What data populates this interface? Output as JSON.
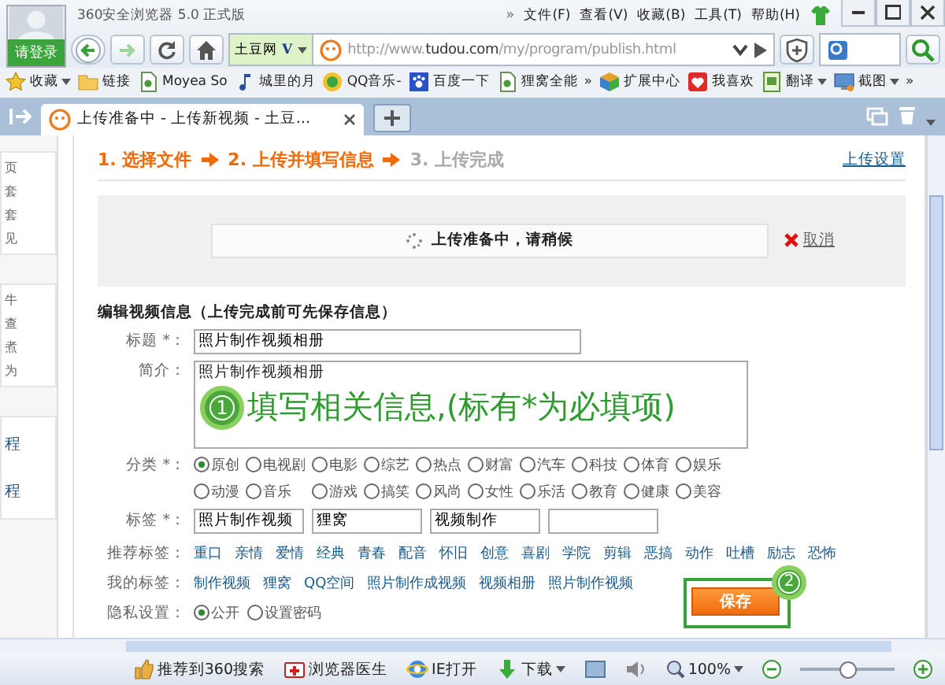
{
  "titlebar": {
    "login": "请登录",
    "title": "360安全浏览器 5.0 正式版",
    "more": "»",
    "menu": [
      "文件(F)",
      "查看(V)",
      "收藏(B)",
      "工具(T)",
      "帮助(H)"
    ]
  },
  "nav": {
    "site": "土豆网",
    "site_v": "V",
    "url_prefix": "http://www.",
    "url_domain": "tudou.com",
    "url_path": "/my/program/publish.html"
  },
  "bookmarks": [
    {
      "label": "收藏",
      "kind": "star",
      "menu": true
    },
    {
      "label": "链接",
      "kind": "folder",
      "menu": false
    },
    {
      "label": "Moyea So",
      "kind": "page",
      "menu": false
    },
    {
      "label": "城里的月",
      "kind": "note",
      "menu": false
    },
    {
      "label": "QQ音乐-",
      "kind": "disc",
      "menu": false
    },
    {
      "label": "百度一下",
      "kind": "paw",
      "menu": false
    },
    {
      "label": "狸窝全能",
      "kind": "page",
      "menu": false
    },
    {
      "label": "»",
      "kind": "more",
      "menu": false
    },
    {
      "label": "扩展中心",
      "kind": "cube",
      "menu": false
    },
    {
      "label": "我喜欢",
      "kind": "heart",
      "menu": false
    },
    {
      "label": "翻译",
      "kind": "book",
      "menu": true
    },
    {
      "label": "截图",
      "kind": "screen",
      "menu": true
    },
    {
      "label": "»",
      "kind": "more",
      "menu": false
    }
  ],
  "tabs": [
    {
      "label": "上传准备中 - 上传新视频 - 土豆...",
      "selected": true
    }
  ],
  "sidebar": {
    "groups": [
      [
        "页",
        "套",
        "套",
        "见"
      ],
      [
        "牛",
        "查",
        "煮",
        "为"
      ],
      [
        "程",
        "程"
      ]
    ]
  },
  "steps": [
    {
      "label": "1. 选择文件",
      "active": true
    },
    {
      "label": "2. 上传并填写信息",
      "active": true
    },
    {
      "label": "3. 上传完成",
      "active": false
    }
  ],
  "upload_settings": "上传设置",
  "progress": {
    "message": "上传准备中，请稍候",
    "cancel": "取消"
  },
  "section_title": "编辑视频信息（上传完成前可先保存信息）",
  "form": {
    "title_label": "标题 *：",
    "title_value": "照片制作视频相册",
    "intro_label": "简介：",
    "intro_value": "照片制作视频相册",
    "callout": {
      "number": "1",
      "text": "填写相关信息,(标有*为必填项)"
    },
    "category_label": "分类 *：",
    "categories": [
      {
        "label": "原创",
        "selected": true
      },
      {
        "label": "电视剧",
        "selected": false
      },
      {
        "label": "电影",
        "selected": false
      },
      {
        "label": "综艺",
        "selected": false
      },
      {
        "label": "热点",
        "selected": false
      },
      {
        "label": "财富",
        "selected": false
      },
      {
        "label": "汽车",
        "selected": false
      },
      {
        "label": "科技",
        "selected": false
      },
      {
        "label": "体育",
        "selected": false
      },
      {
        "label": "娱乐",
        "selected": false
      },
      {
        "label": "动漫",
        "selected": false
      },
      {
        "label": "音乐",
        "selected": false
      },
      {
        "label": "游戏",
        "selected": false
      },
      {
        "label": "搞笑",
        "selected": false
      },
      {
        "label": "风尚",
        "selected": false
      },
      {
        "label": "女性",
        "selected": false
      },
      {
        "label": "乐活",
        "selected": false
      },
      {
        "label": "教育",
        "selected": false
      },
      {
        "label": "健康",
        "selected": false
      },
      {
        "label": "美容",
        "selected": false
      }
    ],
    "tags_label": "标签 *：",
    "tags": [
      {
        "kind": "filled",
        "value": "照片制作视频"
      },
      {
        "kind": "filled",
        "value": "狸窝"
      },
      {
        "kind": "filled",
        "value": "视频制作"
      },
      {
        "kind": "blank"
      }
    ],
    "recommended_label": "推荐标签：",
    "recommended": [
      "重口",
      "亲情",
      "爱情",
      "经典",
      "青春",
      "配音",
      "怀旧",
      "创意",
      "喜剧",
      "学院",
      "剪辑",
      "恶搞",
      "动作",
      "吐槽",
      "励志",
      "恐怖"
    ],
    "my_tags_label": "我的标签：",
    "my_tags": [
      "制作视频",
      "狸窝",
      "QQ空间",
      "照片制作成视频",
      "视频相册",
      "照片制作视频"
    ],
    "privacy_label": "隐私设置：",
    "privacy": [
      {
        "label": "公开",
        "selected": true
      },
      {
        "label": "设置密码",
        "selected": false
      }
    ],
    "save": "保存",
    "save_callout": "2"
  },
  "status_bar": {
    "items": [
      {
        "label": "推荐到360搜索",
        "kind": "thumb",
        "menu": false
      },
      {
        "label": "浏览器医生",
        "kind": "kit",
        "menu": false
      },
      {
        "label": "IE打开",
        "kind": "ie",
        "menu": false
      },
      {
        "label": "下载",
        "kind": "down",
        "menu": true
      }
    ],
    "zoom": "100%",
    "zoom_slider": {
      "level": 0.5
    }
  }
}
